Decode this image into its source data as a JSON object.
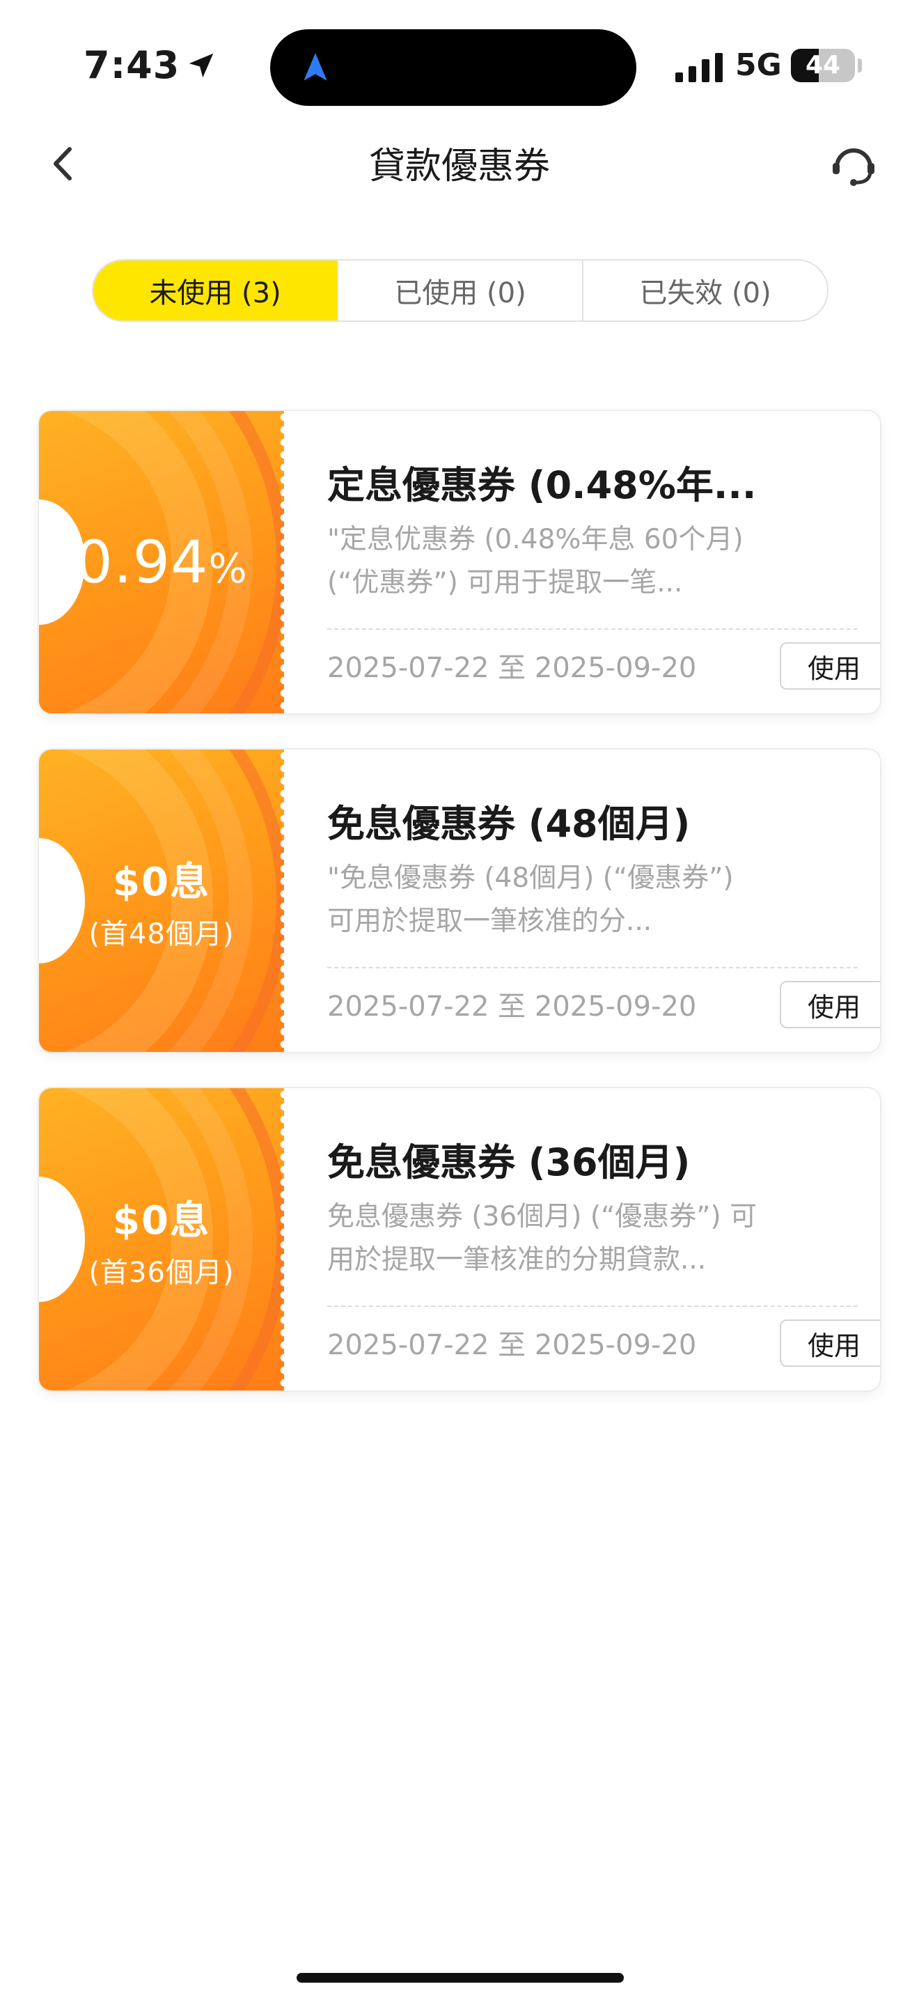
{
  "status_bar": {
    "time": "7:43",
    "network": "5G",
    "battery": "44",
    "battery_level": 0.44
  },
  "nav": {
    "title": "貸款優惠券"
  },
  "tabs": [
    {
      "label": "未使用 (3)",
      "active": true
    },
    {
      "label": "已使用 (0)",
      "active": false
    },
    {
      "label": "已失效 (0)",
      "active": false
    }
  ],
  "coupons": [
    {
      "value_main": "0.94",
      "value_unit": "%",
      "title": "定息優惠券 (0.48%年...",
      "description": "\"定息优惠券 (0.48%年息 60个月) (“优惠券”) 可用于提取一笔...",
      "date_range": "2025-07-22 至 2025-09-20",
      "use_label": "使用"
    },
    {
      "value_main": "$0息",
      "value_sub": "(首48個月)",
      "title": "免息優惠券 (48個月)",
      "description": "\"免息優惠券 (48個月) (“優惠券”) 可用於提取一筆核准的分...",
      "date_range": "2025-07-22 至 2025-09-20",
      "use_label": "使用"
    },
    {
      "value_main": "$0息",
      "value_sub": "(首36個月)",
      "title": "免息優惠券 (36個月)",
      "description": "免息優惠券 (36個月) (“優惠券”) 可用於提取一筆核准的分期貸款...",
      "date_range": "2025-07-22 至 2025-09-20",
      "use_label": "使用"
    }
  ],
  "colors": {
    "tab_active": "#ffe600",
    "coupon_stub_start": "#ffb224",
    "coupon_stub_end": "#ff7d17",
    "island_icon": "#2f7bf5"
  }
}
